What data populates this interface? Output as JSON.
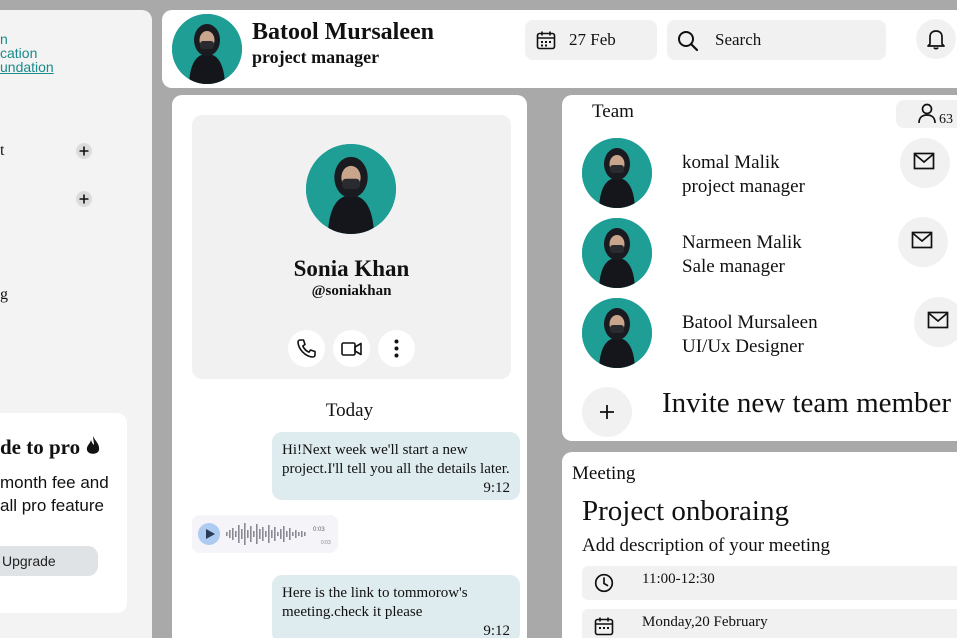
{
  "sidebar": {
    "logo_lines": [
      "n",
      "cation",
      "undation"
    ],
    "items": [
      {
        "label": "t"
      },
      {
        "label": ""
      },
      {
        "label": "g"
      }
    ],
    "promo": {
      "title": "de to pro",
      "text": "month fee and all pro feature",
      "button_label": "Upgrade"
    }
  },
  "header": {
    "user_name": "Batool Mursaleen",
    "user_role": "project manager",
    "date": "27 Feb",
    "search_placeholder": "Search"
  },
  "profile": {
    "name": "Sonia Khan",
    "handle": "@soniakhan",
    "day_label": "Today",
    "messages": [
      {
        "text": "Hi!Next week we'll start a new project.I'll tell you all the details later.",
        "time": "9:12"
      },
      {
        "text": "Here is the link to tommorow's meeting.check it please",
        "time": "9:12"
      }
    ],
    "voice_note": {
      "duration": "0:03",
      "total": "0:03"
    }
  },
  "team": {
    "title": "Team",
    "member_count": "63",
    "members": [
      {
        "name": "komal Malik",
        "role": "project manager"
      },
      {
        "name": "Narmeen Malik",
        "role": "Sale manager"
      },
      {
        "name": "Batool Mursaleen",
        "role": "UI/Ux Designer"
      }
    ],
    "invite_label": "Invite new team member"
  },
  "meeting": {
    "label": "Meeting",
    "title": "Project onboraing",
    "description": "Add description of your meeting",
    "time": "11:00-12:30",
    "date": "Monday,20 February"
  },
  "colors": {
    "background": "#a9a9a9",
    "panel": "#ffffff",
    "pill": "#f1f1f1",
    "bubble": "#dfecef",
    "logo": "#1b8a8a",
    "avatar_bg": "#1f9e95"
  }
}
